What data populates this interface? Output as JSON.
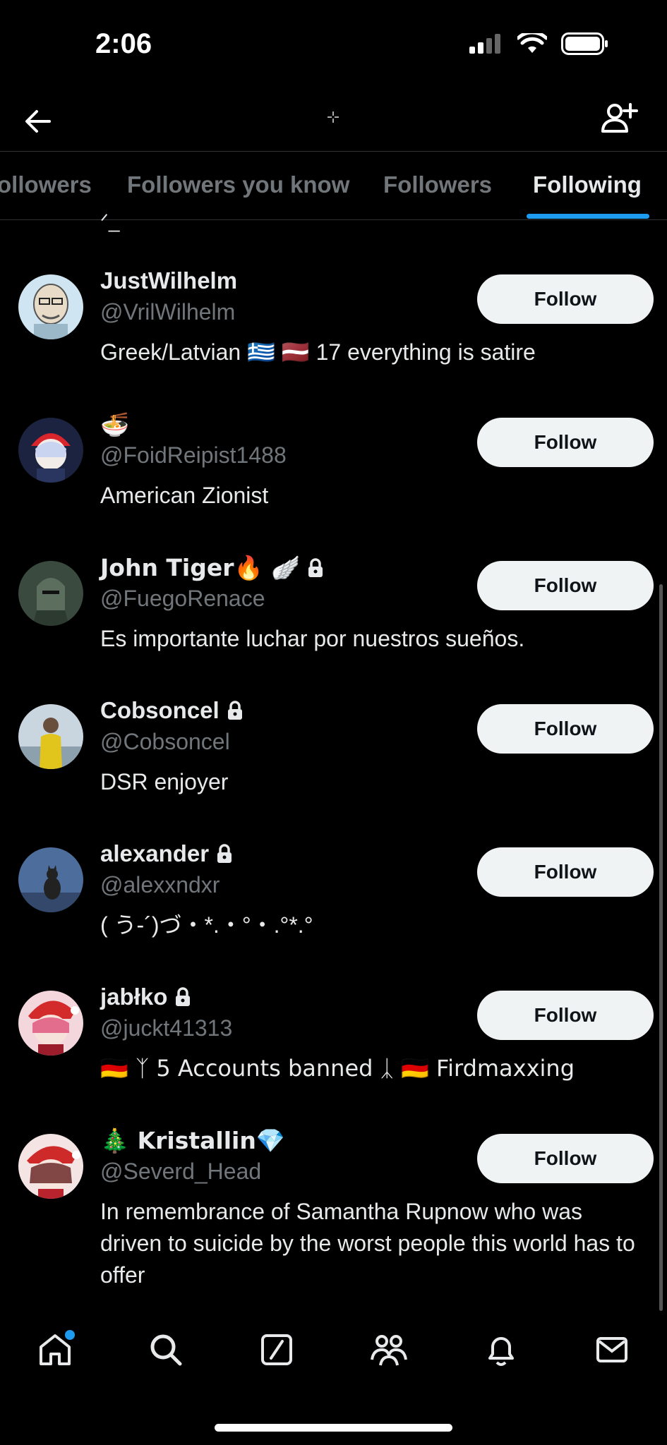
{
  "status_bar": {
    "time": "2:06"
  },
  "tabs": [
    {
      "label": "ollowers",
      "active": false
    },
    {
      "label": "Followers you know",
      "active": false
    },
    {
      "label": "Followers",
      "active": false
    },
    {
      "label": "Following",
      "active": true
    }
  ],
  "cut_text": "ᐟ_",
  "users": [
    {
      "name": "JustWilhelm",
      "handle": "@VrilWilhelm",
      "bio": "Greek/Latvian 🇬🇷 🇱🇻 17 everything is satire",
      "locked": false,
      "follow_label": "Follow"
    },
    {
      "name": "🍜",
      "handle": "@FoidReipist1488",
      "bio": "American Zionist",
      "locked": false,
      "follow_label": "Follow"
    },
    {
      "name": "John Tiger🔥 🪽",
      "handle": "@FuegoRenace",
      "bio": "Es importante luchar por nuestros sueños.",
      "locked": true,
      "follow_label": "Follow"
    },
    {
      "name": "Cobsoncel",
      "handle": "@Cobsoncel",
      "bio": "DSR enjoyer",
      "locked": true,
      "follow_label": "Follow"
    },
    {
      "name": "alexander",
      "handle": "@alexxndxr",
      "bio": "( う-´)づ・*.・°・.°*.°",
      "locked": true,
      "follow_label": "Follow"
    },
    {
      "name": "jabłko",
      "handle": "@juckt41313",
      "bio": "🇩🇪 ᛉ 5 Accounts banned ᛣ 🇩🇪 Firdmaxxing",
      "locked": true,
      "follow_label": "Follow"
    },
    {
      "name": "🎄 Kristallin💎",
      "handle": "@Severd_Head",
      "bio": "In remembrance of Samantha Rupnow who was driven to suicide by the worst people this world has to offer",
      "locked": false,
      "follow_label": "Follow"
    }
  ],
  "bottom_nav": [
    {
      "icon": "home-icon",
      "notification_dot": true
    },
    {
      "icon": "search-icon"
    },
    {
      "icon": "grok-icon"
    },
    {
      "icon": "communities-icon"
    },
    {
      "icon": "notifications-icon"
    },
    {
      "icon": "messages-icon"
    }
  ],
  "colors": {
    "accent": "#1d9bf0",
    "background": "#000000",
    "muted_text": "#71767b"
  }
}
